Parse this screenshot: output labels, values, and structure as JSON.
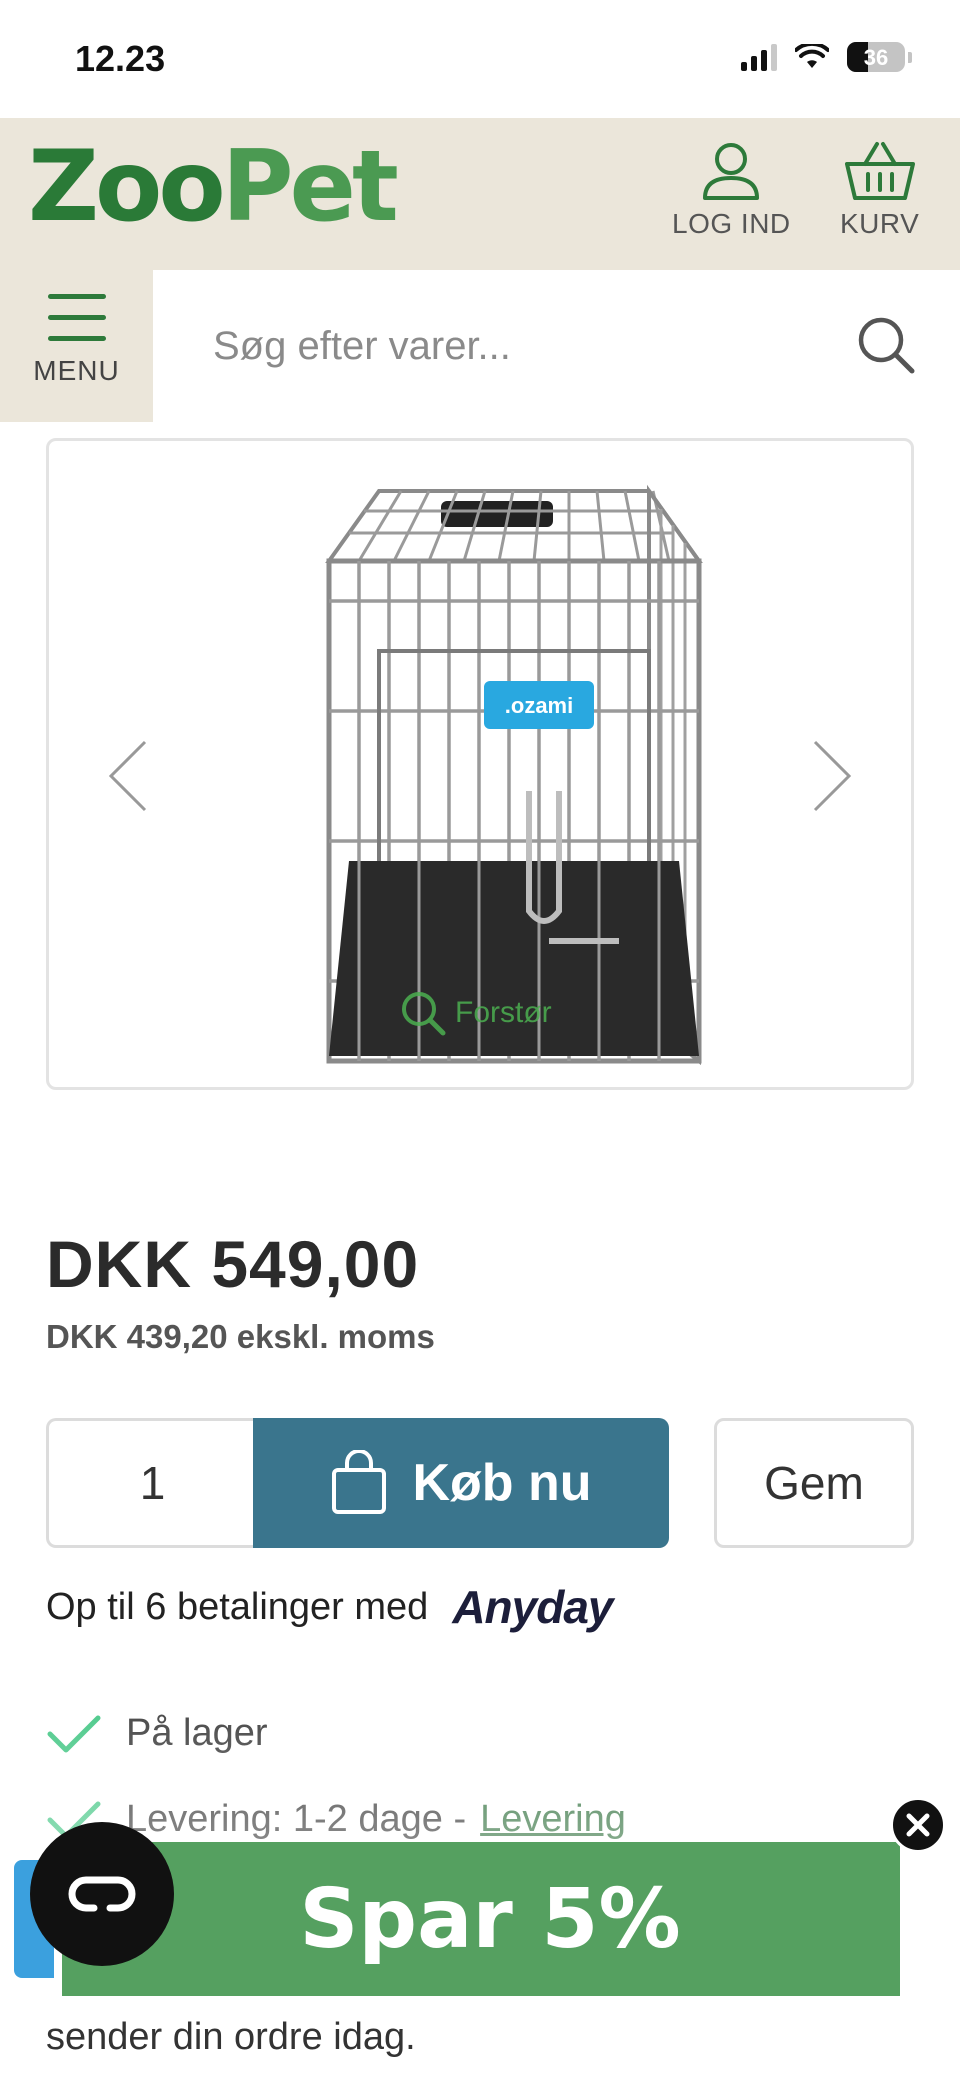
{
  "status_bar": {
    "time": "12.23",
    "battery": "36"
  },
  "header": {
    "logo": {
      "part1": "Zoo",
      "part2": "Pet"
    },
    "login_label": "LOG IND",
    "cart_label": "KURV"
  },
  "nav": {
    "menu_label": "MENU",
    "search_placeholder": "Søg efter varer..."
  },
  "product": {
    "image_badge": ".ozami",
    "zoom_label": "Forstør",
    "price": "DKK 549,00",
    "price_ex_vat": "DKK 439,20 ekskl. moms",
    "quantity": "1",
    "buy_label": "Køb nu",
    "save_label": "Gem",
    "installments_text": "Op til 6 betalinger med",
    "installments_brand": "Anyday",
    "stock_label": "På lager",
    "delivery_label": "Levering: 1-2 dage -",
    "delivery_link": "Levering",
    "trailing_text": "sender din ordre idag."
  },
  "promo": {
    "label": "Spar 5%"
  },
  "colors": {
    "brand_green": "#2a7a37",
    "header_bg": "#ebe6da",
    "buy_button": "#3a758d",
    "promo_green": "#55a060",
    "check_green": "#3bc47f"
  },
  "icons": [
    "user-icon",
    "basket-icon",
    "hamburger-icon",
    "search-icon",
    "chevron-left-icon",
    "chevron-right-icon",
    "zoom-icon",
    "shopping-bag-icon",
    "check-icon",
    "close-icon",
    "chat-icon"
  ]
}
